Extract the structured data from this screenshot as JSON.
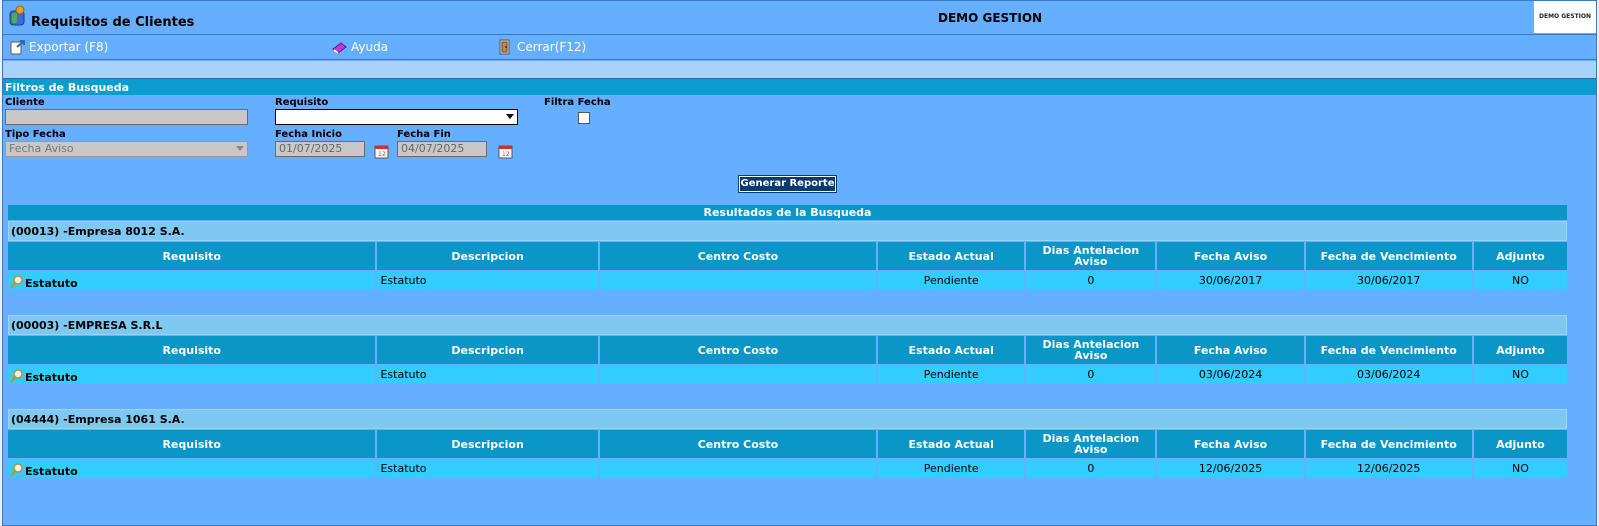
{
  "header": {
    "title": "Requisitos de Clientes",
    "company": "DEMO GESTION",
    "logo_text": "DEMO GESTION"
  },
  "toolbar": {
    "export_label": "Exportar (F8)",
    "help_label": "Ayuda",
    "close_label": "Cerrar(F12)"
  },
  "filters": {
    "header": "Filtros de Busqueda",
    "cliente_label": "Cliente",
    "cliente_value": "",
    "requisito_label": "Requisito",
    "requisito_value": "",
    "filtra_fecha_label": "Filtra Fecha",
    "tipo_fecha_label": "Tipo Fecha",
    "tipo_fecha_value": "Fecha Aviso",
    "fecha_inicio_label": "Fecha Inicio",
    "fecha_inicio_value": "01/07/2025",
    "fecha_fin_label": "Fecha Fin",
    "fecha_fin_value": "04/07/2025",
    "generate_label": "Generar Reporte"
  },
  "results": {
    "header": "Resultados de la Busqueda",
    "columns": [
      "Requisito",
      "Descripcion",
      "Centro Costo",
      "Estado Actual",
      "Dias Antelacion Aviso",
      "Fecha Aviso",
      "Fecha de Vencimiento",
      "Adjunto"
    ],
    "groups": [
      {
        "title": "(00013) -Empresa 8012 S.A.",
        "row": {
          "requisito": "Estatuto",
          "descripcion": "Estatuto",
          "centro_costo": "",
          "estado": "Pendiente",
          "dias": "0",
          "fecha_aviso": "30/06/2017",
          "fecha_venc": "30/06/2017",
          "adjunto": "NO"
        }
      },
      {
        "title": "(00003) -EMPRESA S.R.L",
        "row": {
          "requisito": "Estatuto",
          "descripcion": "Estatuto",
          "centro_costo": "",
          "estado": "Pendiente",
          "dias": "0",
          "fecha_aviso": "03/06/2024",
          "fecha_venc": "03/06/2024",
          "adjunto": "NO"
        }
      },
      {
        "title": "(04444) -Empresa 1061 S.A.",
        "row": {
          "requisito": "Estatuto",
          "descripcion": "Estatuto",
          "centro_costo": "",
          "estado": "Pendiente",
          "dias": "0",
          "fecha_aviso": "12/06/2025",
          "fecha_venc": "12/06/2025",
          "adjunto": "NO"
        }
      }
    ]
  }
}
